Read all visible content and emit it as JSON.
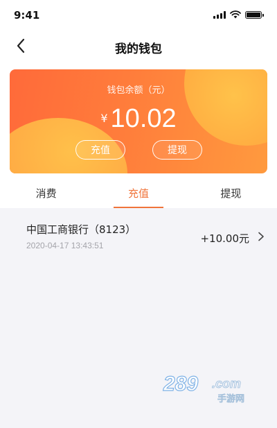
{
  "status_bar": {
    "time": "9:41"
  },
  "nav": {
    "title": "我的钱包",
    "back_icon": "chevron-left-icon"
  },
  "wallet": {
    "label": "钱包余额（元）",
    "currency": "¥",
    "balance": "10.02",
    "recharge_label": "充值",
    "withdraw_label": "提现"
  },
  "tabs": [
    {
      "label": "消费",
      "active": false
    },
    {
      "label": "充值",
      "active": true
    },
    {
      "label": "提现",
      "active": false
    }
  ],
  "records": [
    {
      "bank": "中国工商银行（8123）",
      "time": "2020-04-17 13:43:51",
      "amount": "+10.00元"
    }
  ],
  "watermark": {
    "text": "289.com",
    "sub": "手游网"
  },
  "colors": {
    "accent": "#f0743a",
    "card_start": "#ff6a3a",
    "card_end": "#ff9a3e",
    "background": "#f4f4f8"
  }
}
